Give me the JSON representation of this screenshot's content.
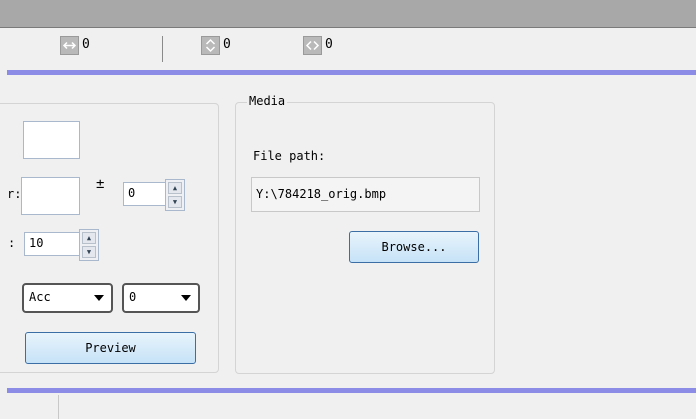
{
  "toolbar": {
    "items": [
      {
        "icon": "horizontal-resize-icon",
        "value": "0"
      },
      {
        "icon": "vertical-expand-icon",
        "value": "0"
      },
      {
        "icon": "horizontal-expand-icon",
        "value": "0"
      }
    ]
  },
  "left_panel": {
    "label_r": "r:",
    "label_colon": ":",
    "plus_minus": "±",
    "offset_value": "0",
    "count_value": "10",
    "mode_select": "Acc",
    "index_select": "0",
    "preview_label": "Preview"
  },
  "media": {
    "legend": "Media",
    "file_path_label": "File path:",
    "file_path_value": "Y:\\784218_orig.bmp",
    "browse_label": "Browse..."
  },
  "colors": {
    "accent": "#8c8ce6",
    "button_border": "#3a6ea5"
  }
}
